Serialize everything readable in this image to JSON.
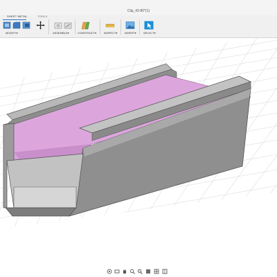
{
  "window": {
    "title": "Clip_43-80*(1)"
  },
  "tabs": [
    {
      "label": "SHEET METAL",
      "active": true
    },
    {
      "label": "TOOLS",
      "active": false
    }
  ],
  "groups": {
    "modify": "MODIFY",
    "assemble": "ASSEMBLE",
    "construct": "CONSTRUCT",
    "inspect": "INSPECT",
    "insert": "INSERT",
    "select": "SELECT"
  },
  "colors": {
    "accent": "#2b77c4",
    "body_face_light": "#bdbdbd",
    "body_face_dark": "#767676",
    "highlight_face": "#dca6dc"
  },
  "nav_icons": [
    "orbit-icon",
    "look-at-icon",
    "pan-icon",
    "zoom-icon",
    "fit-icon",
    "display-settings-icon",
    "grid-settings-icon",
    "viewports-icon"
  ]
}
